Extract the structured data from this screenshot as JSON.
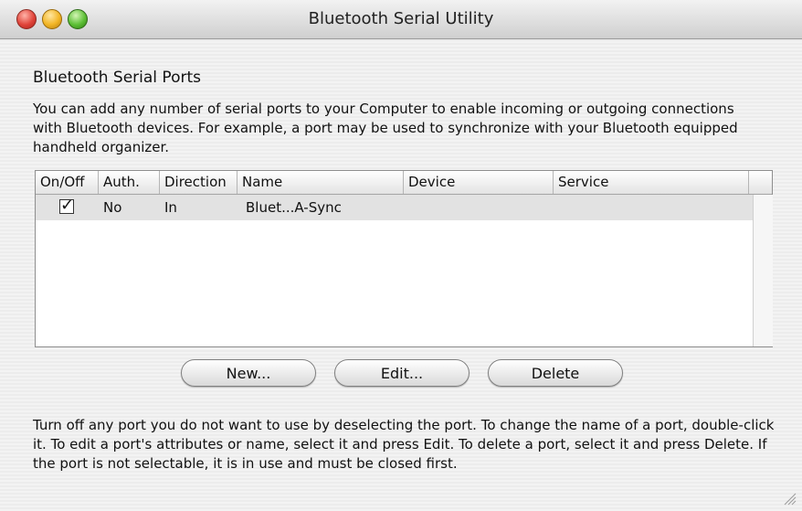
{
  "window": {
    "title": "Bluetooth Serial Utility"
  },
  "section": {
    "heading": "Bluetooth Serial Ports",
    "description": "You can add any number of serial ports to your Computer to enable incoming or outgoing connections with Bluetooth devices.  For example, a port may be used to synchronize with your Bluetooth equipped handheld organizer."
  },
  "table": {
    "columns": [
      "On/Off",
      "Auth.",
      "Direction",
      "Name",
      "Device",
      "Service"
    ],
    "rows": [
      {
        "on_off": "✓",
        "auth": "No",
        "direction": "In",
        "name": "Bluet...A-Sync",
        "device": "",
        "service": ""
      }
    ]
  },
  "buttons": {
    "new": "New...",
    "edit": "Edit...",
    "delete": "Delete"
  },
  "footer": "Turn off any port you do not want to use by deselecting the port. To change the name of a port, double-click it. To edit a port's attributes or name, select it and press Edit. To delete a port, select it and press Delete. If the port is not selectable, it is in use and must be closed first."
}
